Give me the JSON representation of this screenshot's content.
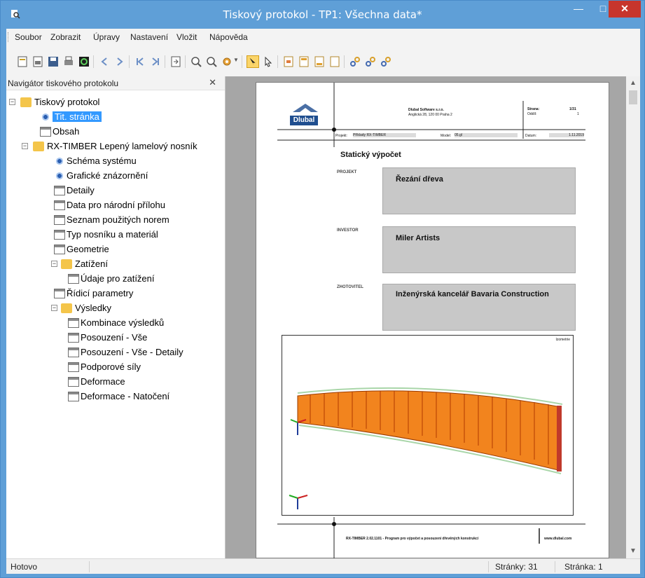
{
  "window": {
    "title": "Tiskový protokol - TP1: Všechna data*"
  },
  "menu": [
    "Soubor",
    "Zobrazit",
    "Úpravy",
    "Nastavení",
    "Vložit",
    "Nápověda"
  ],
  "navigator": {
    "title": "Navigátor tiskového protokolu",
    "items": [
      {
        "label": "Tiskový protokol",
        "icon": "folder-icon"
      },
      {
        "label": "Tit. stránka",
        "icon": "eye-icon",
        "selected": true
      },
      {
        "label": "Obsah",
        "icon": "table-of-contents-icon"
      },
      {
        "label": "RX-TIMBER Lepený lamelový nosník",
        "icon": "folder-icon"
      },
      {
        "label": "Schéma systému",
        "icon": "eye-icon"
      },
      {
        "label": "Grafické znázornění",
        "icon": "eye-icon"
      },
      {
        "label": "Detaily",
        "icon": "table-icon"
      },
      {
        "label": "Data pro národní přílohu",
        "icon": "table-icon"
      },
      {
        "label": "Seznam použitých norem",
        "icon": "table-icon"
      },
      {
        "label": "Typ nosníku a materiál",
        "icon": "table-icon"
      },
      {
        "label": "Geometrie",
        "icon": "table-icon"
      },
      {
        "label": "Zatížení",
        "icon": "folder-icon"
      },
      {
        "label": "Údaje pro zatížení",
        "icon": "table-icon"
      },
      {
        "label": "Řídicí parametry",
        "icon": "table-icon"
      },
      {
        "label": "Výsledky",
        "icon": "folder-icon"
      },
      {
        "label": "Kombinace výsledků",
        "icon": "table-icon"
      },
      {
        "label": "Posouzení - Vše",
        "icon": "table-icon"
      },
      {
        "label": "Posouzení - Vše - Detaily",
        "icon": "table-icon"
      },
      {
        "label": "Podporové síly",
        "icon": "table-icon"
      },
      {
        "label": "Deformace",
        "icon": "table-icon"
      },
      {
        "label": "Deformace - Natočení",
        "icon": "table-icon"
      }
    ]
  },
  "page": {
    "logo": "Dlubal",
    "company": "Dlubal Software s.r.o.",
    "address": "Anglická 28, 120 00 Praha 2",
    "strana_label": "Strana:",
    "strana_value": "1/31",
    "oddil_label": "Oddíl:",
    "oddil_value": "1",
    "projekt_label": "Projekt:",
    "projekt_value": "Příklady RX-TIMBER",
    "model_label": "Model:",
    "model_value": "05.gl",
    "datum_label": "Datum:",
    "datum_value": "1.11.2019",
    "heading": "Statický výpočet",
    "sections": [
      {
        "label": "PROJEKT",
        "value": "Řezání dřeva"
      },
      {
        "label": "INVESTOR",
        "value": "Miler Artists"
      },
      {
        "label": "ZHOTOVITEL",
        "value": "Inženýrská kancelář Bavaria Construction"
      }
    ],
    "view_label": "Izometrie",
    "footer_left": "RX-TIMBER 2.02.1101 - Program pro výpočet a posouzení dřevěných konstrukcí",
    "footer_right": "www.dlubal.com"
  },
  "status": {
    "left": "Hotovo",
    "pages": "Stránky: 31",
    "page": "Stránka: 1"
  }
}
